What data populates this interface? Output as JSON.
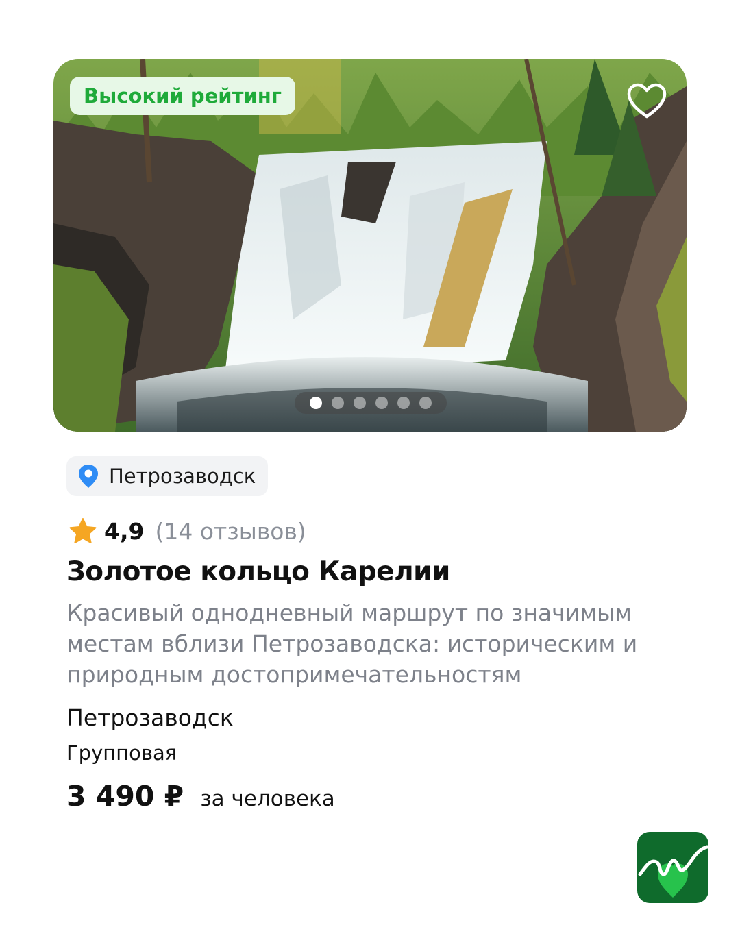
{
  "card": {
    "badge": "Высокий рейтинг",
    "favorite_icon": "heart-outline-icon",
    "carousel": {
      "total": 6,
      "active": 1
    },
    "location_chip": {
      "icon": "map-pin-icon",
      "label": "Петрозаводск"
    },
    "rating": {
      "icon": "star-icon",
      "value": "4,9",
      "reviews": "(14 отзывов)"
    },
    "title": "Золотое кольцо Карелии",
    "description": "Красивый однодневный маршрут по значимым местам вблизи Петрозаводска: историческим и природным достопримечательностям",
    "city": "Петрозаводск",
    "tour_type": "Групповая",
    "price": {
      "amount": "3 490 ₽",
      "per": "за человека"
    }
  },
  "logo": {
    "icon": "app-logo-icon"
  },
  "colors": {
    "badge_text": "#1faa3a",
    "badge_bg": "#e7f8e7",
    "pin_blue": "#2f8cf5",
    "star": "#f5a623",
    "muted_text": "#7d818a",
    "logo_green": "#0f6b2c"
  }
}
